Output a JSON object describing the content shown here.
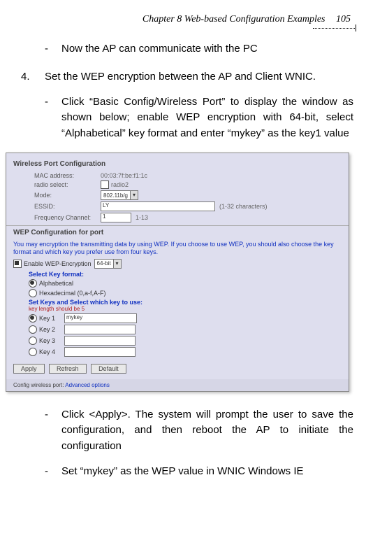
{
  "header": {
    "chapter": "Chapter 8 Web-based Configuration Examples",
    "page": "105"
  },
  "line1": "Now the AP can communicate with the PC",
  "step4_marker": "4.",
  "step4_text": "Set the WEP encryption between the AP and Client WNIC.",
  "sub1": "Click “Basic Config/Wireless Port” to display the window as shown below; enable WEP encryption with 64-bit, select “Alphabetical” key format and enter “mykey” as the key1 value",
  "shot": {
    "title1": "Wireless Port Configuration",
    "mac_label": "MAC address:",
    "mac_value": "00:03:7f:be:f1:1c",
    "radio_label": "radio select:",
    "radio_value": "radio2",
    "mode_label": "Mode:",
    "mode_value": "802.11b/g",
    "essid_label": "ESSID:",
    "essid_value": "LY",
    "essid_hint": "(1-32 characters)",
    "freq_label": "Frequency Channel:",
    "freq_value": "1",
    "freq_hint": "1-13",
    "title2": "WEP Configuration for port",
    "note": "You may encryption the transmitting data by using WEP. If you choose to use WEP, you should also choose the key format and which key you prefer use from four keys.",
    "enable_label": "Enable WEP-Encryption",
    "enable_value": "64-bit",
    "sel_fmt": "Select Key format:",
    "fmt_alpha": "Alphabetical",
    "fmt_hex": "Hexadecimal (0,a-f,A-F)",
    "setkeys": "Set Keys and Select which key to use:",
    "keylen": "key length should be 5",
    "k1": "Key 1",
    "k1v": "mykey",
    "k2": "Key 2",
    "k3": "Key 3",
    "k4": "Key 4",
    "b_apply": "Apply",
    "b_refresh": "Refresh",
    "b_default": "Default",
    "footer": "Config wireless port:",
    "footer_link": "Advanced options"
  },
  "sub2": "Click <Apply>. The system will prompt the user to save the configuration, and then reboot the AP to initiate the configuration",
  "sub3": "Set “mykey” as the WEP value in WNIC Windows IE"
}
